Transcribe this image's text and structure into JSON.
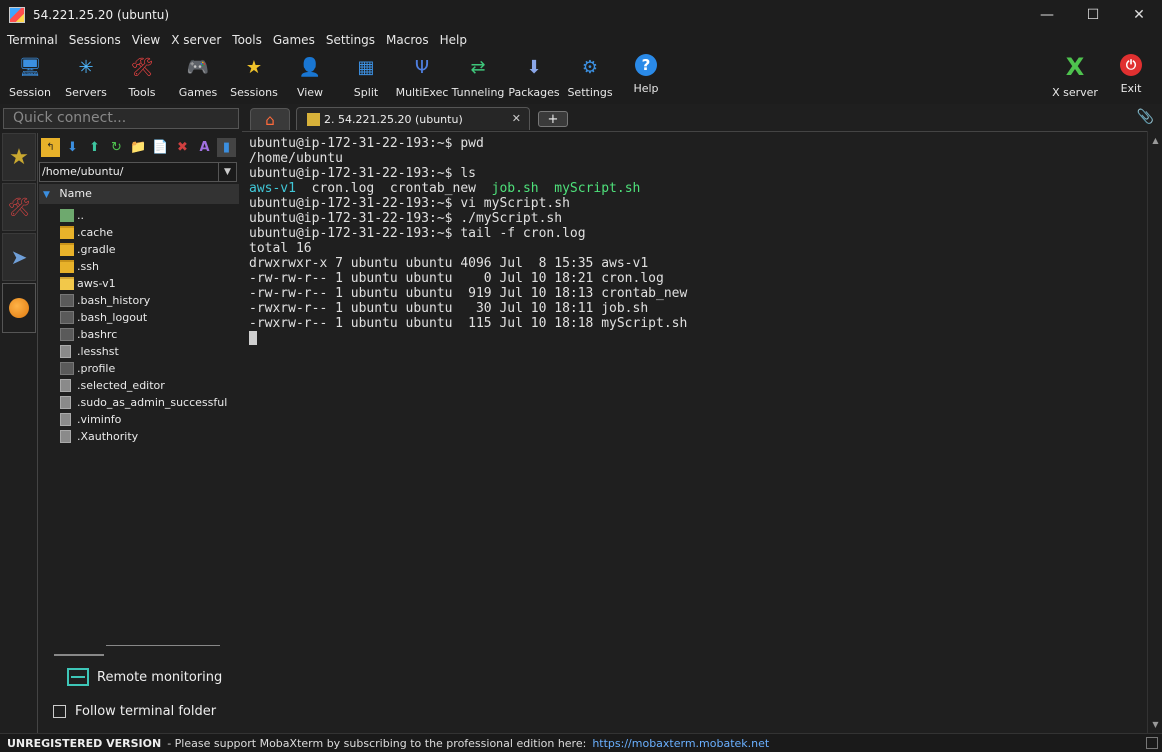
{
  "window": {
    "title": "54.221.25.20 (ubuntu)",
    "controls": [
      "—",
      "☐",
      "✕"
    ]
  },
  "menu": [
    "Terminal",
    "Sessions",
    "View",
    "X server",
    "Tools",
    "Games",
    "Settings",
    "Macros",
    "Help"
  ],
  "toolbar": [
    {
      "label": "Session",
      "icon": "session-icon",
      "glyph": "🖥",
      "color": "#3b8fe0"
    },
    {
      "label": "Servers",
      "icon": "servers-icon",
      "glyph": "✳",
      "color": "#4fb8ff"
    },
    {
      "label": "Tools",
      "icon": "tools-icon",
      "glyph": "🛠",
      "color": "#e04040"
    },
    {
      "label": "Games",
      "icon": "games-icon",
      "glyph": "🎮",
      "color": "#dddddd"
    },
    {
      "label": "Sessions",
      "icon": "star-icon",
      "glyph": "★",
      "color": "#f2c42a"
    },
    {
      "label": "View",
      "icon": "view-icon",
      "glyph": "👤",
      "color": "#8fd28f"
    },
    {
      "label": "Split",
      "icon": "split-icon",
      "glyph": "▦",
      "color": "#3b8fe0"
    },
    {
      "label": "MultiExec",
      "icon": "multiexec-icon",
      "glyph": "Ψ",
      "color": "#4f7fe0"
    },
    {
      "label": "Tunneling",
      "icon": "tunneling-icon",
      "glyph": "⇄",
      "color": "#3ec67a"
    },
    {
      "label": "Packages",
      "icon": "packages-icon",
      "glyph": "⬇",
      "color": "#8aa6e8"
    },
    {
      "label": "Settings",
      "icon": "settings-icon",
      "glyph": "⚙",
      "color": "#3b8fe0"
    },
    {
      "label": "Help",
      "icon": "help-icon",
      "glyph": "?",
      "color": "#ffffff"
    }
  ],
  "toolbar_right": [
    {
      "label": "X server",
      "icon": "xserver-icon",
      "glyph": "X",
      "color": "#4ec24e"
    },
    {
      "label": "Exit",
      "icon": "exit-icon",
      "glyph": "⏻",
      "color": "#ffffff"
    }
  ],
  "quick_connect": {
    "placeholder": "Quick connect..."
  },
  "file_panel": {
    "path": "/home/ubuntu/",
    "column": "Name",
    "files": [
      {
        "name": "..",
        "type": "up"
      },
      {
        "name": ".cache",
        "type": "folder"
      },
      {
        "name": ".gradle",
        "type": "folder"
      },
      {
        "name": ".ssh",
        "type": "folder"
      },
      {
        "name": "aws-v1",
        "type": "folder-open"
      },
      {
        "name": ".bash_history",
        "type": "bin"
      },
      {
        "name": ".bash_logout",
        "type": "bin"
      },
      {
        "name": ".bashrc",
        "type": "bin"
      },
      {
        "name": ".lesshst",
        "type": "doc"
      },
      {
        "name": ".profile",
        "type": "bin"
      },
      {
        "name": ".selected_editor",
        "type": "doc"
      },
      {
        "name": ".sudo_as_admin_successful",
        "type": "doc"
      },
      {
        "name": ".viminfo",
        "type": "doc"
      },
      {
        "name": ".Xauthority",
        "type": "doc"
      }
    ],
    "remote_monitoring": "Remote monitoring",
    "follow_folder": "Follow terminal folder"
  },
  "tabs": {
    "session_label": "2. 54.221.25.20 (ubuntu)",
    "new_tab": "+"
  },
  "terminal": {
    "lines": [
      [
        {
          "t": "ubuntu@ip-172-31-22-193:~$ pwd"
        }
      ],
      [
        {
          "t": "/home/ubuntu"
        }
      ],
      [
        {
          "t": "ubuntu@ip-172-31-22-193:~$ ls"
        }
      ],
      [
        {
          "t": "aws-v1",
          "c": "cyan"
        },
        {
          "t": "  cron.log  crontab_new  "
        },
        {
          "t": "job.sh",
          "c": "green"
        },
        {
          "t": "  "
        },
        {
          "t": "myScript.sh",
          "c": "green"
        }
      ],
      [
        {
          "t": "ubuntu@ip-172-31-22-193:~$ vi myScript.sh"
        }
      ],
      [
        {
          "t": "ubuntu@ip-172-31-22-193:~$ ./myScript.sh"
        }
      ],
      [
        {
          "t": "ubuntu@ip-172-31-22-193:~$ tail -f cron.log"
        }
      ],
      [
        {
          "t": "total 16"
        }
      ],
      [
        {
          "t": "drwxrwxr-x 7 ubuntu ubuntu 4096 Jul  8 15:35 aws-v1"
        }
      ],
      [
        {
          "t": "-rw-rw-r-- 1 ubuntu ubuntu    0 Jul 10 18:21 cron.log"
        }
      ],
      [
        {
          "t": "-rw-rw-r-- 1 ubuntu ubuntu  919 Jul 10 18:13 crontab_new"
        }
      ],
      [
        {
          "t": "-rwxrw-r-- 1 ubuntu ubuntu   30 Jul 10 18:11 job.sh"
        }
      ],
      [
        {
          "t": "-rwxrw-r-- 1 ubuntu ubuntu  115 Jul 10 18:18 myScript.sh"
        }
      ]
    ]
  },
  "status": {
    "unregistered": "UNREGISTERED VERSION",
    "message": "-  Please support MobaXterm by subscribing to the professional edition here:",
    "link": "https://mobaxterm.mobatek.net"
  }
}
